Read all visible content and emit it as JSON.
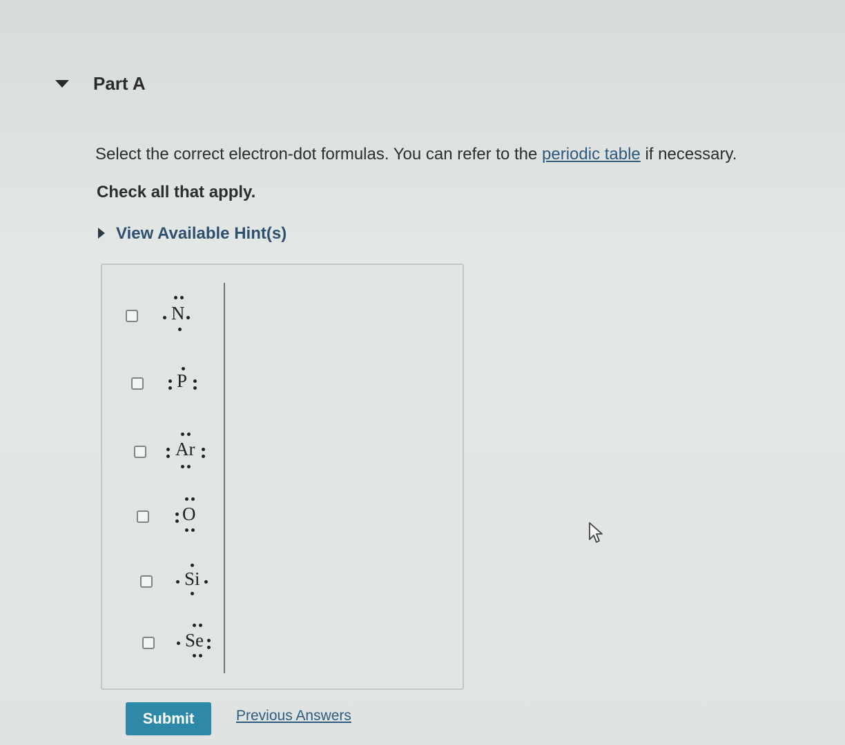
{
  "part": {
    "title": "Part A"
  },
  "question": {
    "prompt_before_link": "Select the correct electron-dot formulas. You can refer to the ",
    "link_text": "periodic table",
    "prompt_after_link": " if necessary.",
    "instruction": "Check all that apply."
  },
  "hints": {
    "label": "View Available Hint(s)"
  },
  "options": [
    {
      "symbol": "N",
      "checked": false
    },
    {
      "symbol": "P",
      "checked": false
    },
    {
      "symbol": "Ar",
      "checked": false
    },
    {
      "symbol": "O",
      "checked": false
    },
    {
      "symbol": "Si",
      "checked": false
    },
    {
      "symbol": "Se",
      "checked": false
    }
  ],
  "actions": {
    "submit_label": "Submit",
    "previous_answers_label": "Previous Answers"
  },
  "colors": {
    "accent": "#2e89a8",
    "link": "#2e5a80"
  }
}
